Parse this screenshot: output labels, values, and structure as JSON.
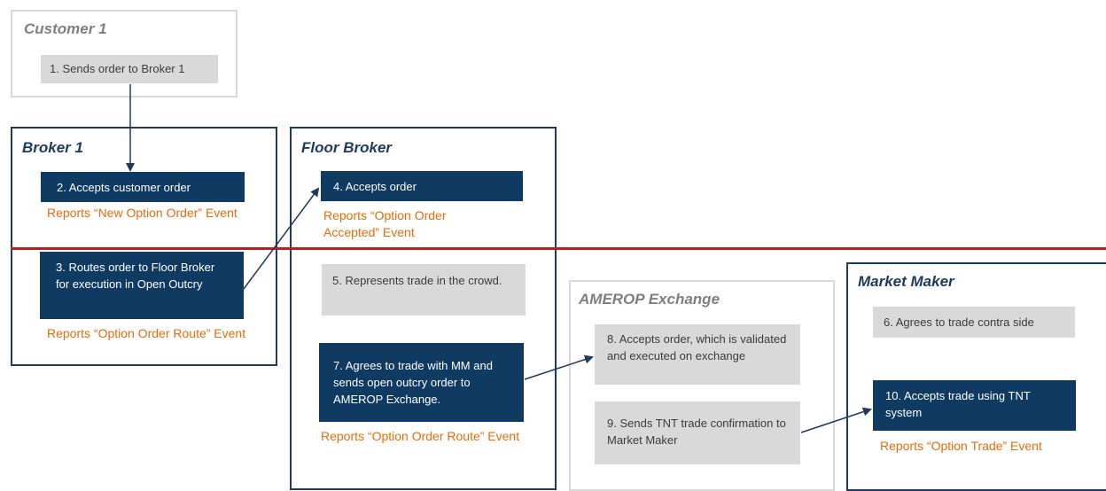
{
  "panels": {
    "customer1": "Customer 1",
    "broker1": "Broker 1",
    "floor_broker": "Floor Broker",
    "amerop": "AMEROP Exchange",
    "market_maker": "Market Maker"
  },
  "steps": {
    "s1": "1. Sends order to Broker 1",
    "s2": "2. Accepts customer order",
    "s3": "3. Routes order to Floor Broker for execution in Open Outcry",
    "s4": "4. Accepts order",
    "s5": "5. Represents trade in the crowd.",
    "s6": "6. Agrees to trade contra side",
    "s7": "7. Agrees to trade with MM and sends open outcry order to AMEROP Exchange.",
    "s8": "8. Accepts order, which is validated and executed on exchange",
    "s9": "9. Sends TNT trade confirmation to Market Maker",
    "s10": "10. Accepts trade using TNT system"
  },
  "events": {
    "e_new_order": "Reports “New Option Order” Event",
    "e_route_broker": "Reports “Option Order Route” Event",
    "e_accepted": "Reports “Option Order Accepted” Event",
    "e_route_floor": "Reports “Option Order Route” Event",
    "e_trade": "Reports “Option Trade” Event"
  },
  "colors": {
    "navy": "#0f3b63",
    "grey_box": "#d9d9d9",
    "event_orange": "#e46c0a",
    "divider_red": "#b22222"
  }
}
